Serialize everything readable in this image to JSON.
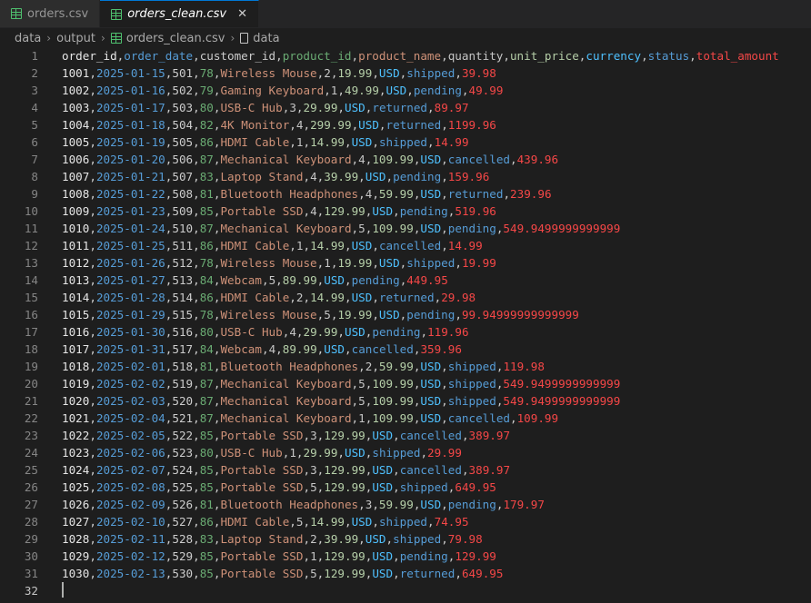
{
  "tabs": [
    {
      "label": "orders.csv",
      "active": false
    },
    {
      "label": "orders_clean.csv",
      "active": true,
      "close": "✕"
    }
  ],
  "breadcrumb": [
    "data",
    "output",
    "orders_clean.csv",
    "data"
  ],
  "colors": {
    "order_id": "#e6e6e6",
    "order_date": "#569cd6",
    "customer_id": "#cccccc",
    "product_id": "#6aab73",
    "product_name": "#ce9178",
    "quantity": "#c6c6c6",
    "unit_price": "#b5cea8",
    "currency": "#4fc1ff",
    "status": "#569cd6",
    "total_amount": "#f44747"
  },
  "header": [
    "order_id",
    "order_date",
    "customer_id",
    "product_id",
    "product_name",
    "quantity",
    "unit_price",
    "currency",
    "status",
    "total_amount"
  ],
  "rows": [
    [
      "1001",
      "2025-01-15",
      "501",
      "78",
      "Wireless Mouse",
      "2",
      "19.99",
      "USD",
      "shipped",
      "39.98"
    ],
    [
      "1002",
      "2025-01-16",
      "502",
      "79",
      "Gaming Keyboard",
      "1",
      "49.99",
      "USD",
      "pending",
      "49.99"
    ],
    [
      "1003",
      "2025-01-17",
      "503",
      "80",
      "USB-C Hub",
      "3",
      "29.99",
      "USD",
      "returned",
      "89.97"
    ],
    [
      "1004",
      "2025-01-18",
      "504",
      "82",
      "4K Monitor",
      "4",
      "299.99",
      "USD",
      "returned",
      "1199.96"
    ],
    [
      "1005",
      "2025-01-19",
      "505",
      "86",
      "HDMI Cable",
      "1",
      "14.99",
      "USD",
      "shipped",
      "14.99"
    ],
    [
      "1006",
      "2025-01-20",
      "506",
      "87",
      "Mechanical Keyboard",
      "4",
      "109.99",
      "USD",
      "cancelled",
      "439.96"
    ],
    [
      "1007",
      "2025-01-21",
      "507",
      "83",
      "Laptop Stand",
      "4",
      "39.99",
      "USD",
      "pending",
      "159.96"
    ],
    [
      "1008",
      "2025-01-22",
      "508",
      "81",
      "Bluetooth Headphones",
      "4",
      "59.99",
      "USD",
      "returned",
      "239.96"
    ],
    [
      "1009",
      "2025-01-23",
      "509",
      "85",
      "Portable SSD",
      "4",
      "129.99",
      "USD",
      "pending",
      "519.96"
    ],
    [
      "1010",
      "2025-01-24",
      "510",
      "87",
      "Mechanical Keyboard",
      "5",
      "109.99",
      "USD",
      "pending",
      "549.9499999999999"
    ],
    [
      "1011",
      "2025-01-25",
      "511",
      "86",
      "HDMI Cable",
      "1",
      "14.99",
      "USD",
      "cancelled",
      "14.99"
    ],
    [
      "1012",
      "2025-01-26",
      "512",
      "78",
      "Wireless Mouse",
      "1",
      "19.99",
      "USD",
      "shipped",
      "19.99"
    ],
    [
      "1013",
      "2025-01-27",
      "513",
      "84",
      "Webcam",
      "5",
      "89.99",
      "USD",
      "pending",
      "449.95"
    ],
    [
      "1014",
      "2025-01-28",
      "514",
      "86",
      "HDMI Cable",
      "2",
      "14.99",
      "USD",
      "returned",
      "29.98"
    ],
    [
      "1015",
      "2025-01-29",
      "515",
      "78",
      "Wireless Mouse",
      "5",
      "19.99",
      "USD",
      "pending",
      "99.94999999999999"
    ],
    [
      "1016",
      "2025-01-30",
      "516",
      "80",
      "USB-C Hub",
      "4",
      "29.99",
      "USD",
      "pending",
      "119.96"
    ],
    [
      "1017",
      "2025-01-31",
      "517",
      "84",
      "Webcam",
      "4",
      "89.99",
      "USD",
      "cancelled",
      "359.96"
    ],
    [
      "1018",
      "2025-02-01",
      "518",
      "81",
      "Bluetooth Headphones",
      "2",
      "59.99",
      "USD",
      "shipped",
      "119.98"
    ],
    [
      "1019",
      "2025-02-02",
      "519",
      "87",
      "Mechanical Keyboard",
      "5",
      "109.99",
      "USD",
      "shipped",
      "549.9499999999999"
    ],
    [
      "1020",
      "2025-02-03",
      "520",
      "87",
      "Mechanical Keyboard",
      "5",
      "109.99",
      "USD",
      "shipped",
      "549.9499999999999"
    ],
    [
      "1021",
      "2025-02-04",
      "521",
      "87",
      "Mechanical Keyboard",
      "1",
      "109.99",
      "USD",
      "cancelled",
      "109.99"
    ],
    [
      "1022",
      "2025-02-05",
      "522",
      "85",
      "Portable SSD",
      "3",
      "129.99",
      "USD",
      "cancelled",
      "389.97"
    ],
    [
      "1023",
      "2025-02-06",
      "523",
      "80",
      "USB-C Hub",
      "1",
      "29.99",
      "USD",
      "shipped",
      "29.99"
    ],
    [
      "1024",
      "2025-02-07",
      "524",
      "85",
      "Portable SSD",
      "3",
      "129.99",
      "USD",
      "cancelled",
      "389.97"
    ],
    [
      "1025",
      "2025-02-08",
      "525",
      "85",
      "Portable SSD",
      "5",
      "129.99",
      "USD",
      "shipped",
      "649.95"
    ],
    [
      "1026",
      "2025-02-09",
      "526",
      "81",
      "Bluetooth Headphones",
      "3",
      "59.99",
      "USD",
      "pending",
      "179.97"
    ],
    [
      "1027",
      "2025-02-10",
      "527",
      "86",
      "HDMI Cable",
      "5",
      "14.99",
      "USD",
      "shipped",
      "74.95"
    ],
    [
      "1028",
      "2025-02-11",
      "528",
      "83",
      "Laptop Stand",
      "2",
      "39.99",
      "USD",
      "shipped",
      "79.98"
    ],
    [
      "1029",
      "2025-02-12",
      "529",
      "85",
      "Portable SSD",
      "1",
      "129.99",
      "USD",
      "pending",
      "129.99"
    ],
    [
      "1030",
      "2025-02-13",
      "530",
      "85",
      "Portable SSD",
      "5",
      "129.99",
      "USD",
      "returned",
      "649.95"
    ]
  ],
  "last_line_number": "32"
}
